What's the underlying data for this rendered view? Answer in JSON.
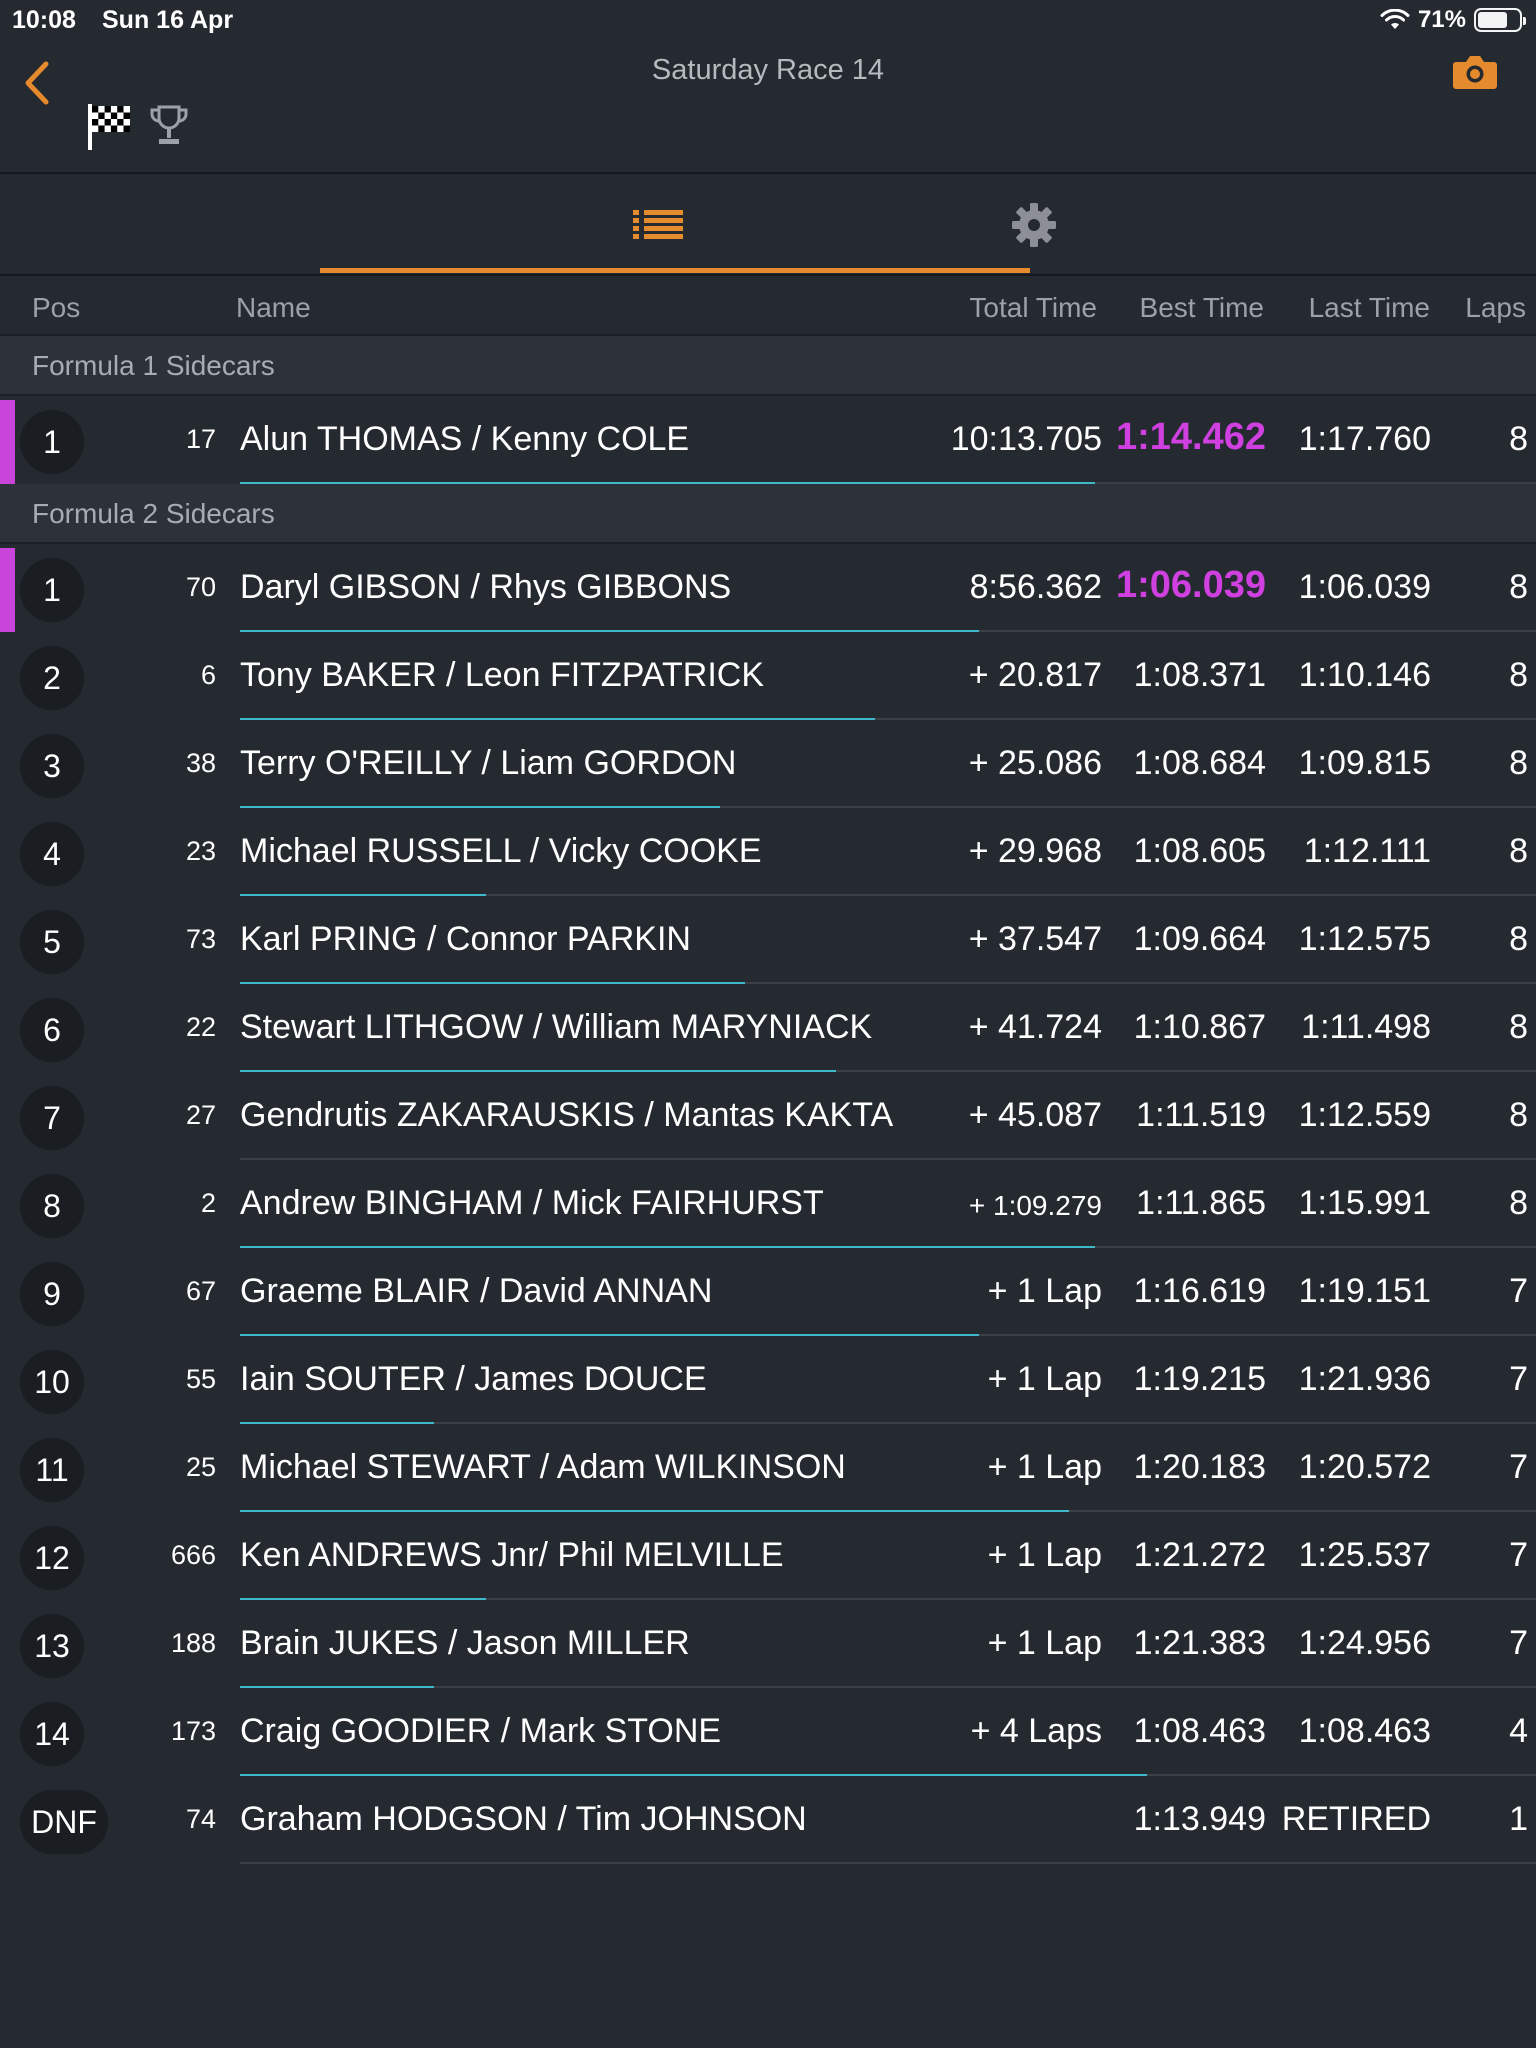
{
  "status_bar": {
    "time": "10:08",
    "date": "Sun 16 Apr",
    "battery": "71%"
  },
  "header": {
    "title": "Saturday Race 14"
  },
  "icons": {
    "back": "chevron-left-icon",
    "camera": "camera-icon",
    "flag": "checkered-flag-icon",
    "trophy": "trophy-icon",
    "list": "list-icon",
    "settings": "gear-icon"
  },
  "colors": {
    "accent": "#e68a2e",
    "fastest": "#d040e0",
    "progress": "#3fb9c8",
    "background": "#252a31"
  },
  "columns": {
    "pos": "Pos",
    "name": "Name",
    "total": "Total Time",
    "best": "Best Time",
    "last": "Last Time",
    "laps": "Laps"
  },
  "groups": [
    {
      "title": "Formula 1 Sidecars",
      "rows": [
        {
          "pos": "1",
          "num": "17",
          "name": "Alun THOMAS / Kenny COLE",
          "total": "10:13.705",
          "best": "1:14.462",
          "last": "1:17.760",
          "laps": "8",
          "leader": true,
          "fastest": true,
          "progress": 0.66
        }
      ]
    },
    {
      "title": "Formula 2 Sidecars",
      "rows": [
        {
          "pos": "1",
          "num": "70",
          "name": "Daryl GIBSON / Rhys GIBBONS",
          "total": "8:56.362",
          "best": "1:06.039",
          "last": "1:06.039",
          "laps": "8",
          "leader": true,
          "fastest": true,
          "progress": 0.57
        },
        {
          "pos": "2",
          "num": "6",
          "name": "Tony BAKER / Leon FITZPATRICK",
          "total": "+ 20.817",
          "best": "1:08.371",
          "last": "1:10.146",
          "laps": "8",
          "progress": 0.49
        },
        {
          "pos": "3",
          "num": "38",
          "name": "Terry O'REILLY /  Liam GORDON",
          "total": "+ 25.086",
          "best": "1:08.684",
          "last": "1:09.815",
          "laps": "8",
          "progress": 0.37
        },
        {
          "pos": "4",
          "num": "23",
          "name": "Michael RUSSELL /  Vicky COOKE",
          "total": "+ 29.968",
          "best": "1:08.605",
          "last": "1:12.111",
          "laps": "8",
          "progress": 0.19
        },
        {
          "pos": "5",
          "num": "73",
          "name": "Karl PRING / Connor PARKIN",
          "total": "+ 37.547",
          "best": "1:09.664",
          "last": "1:12.575",
          "laps": "8",
          "progress": 0.39
        },
        {
          "pos": "6",
          "num": "22",
          "name": "Stewart LITHGOW / William MARYNIACK",
          "total": "+ 41.724",
          "best": "1:10.867",
          "last": "1:11.498",
          "laps": "8",
          "progress": 0.46
        },
        {
          "pos": "7",
          "num": "27",
          "name": "Gendrutis ZAKARAUSKIS / Mantas KAKTA",
          "total": "+ 45.087",
          "best": "1:11.519",
          "last": "1:12.559",
          "laps": "8",
          "progress": 0.0
        },
        {
          "pos": "8",
          "num": "2",
          "name": "Andrew BINGHAM /  Mick FAIRHURST",
          "total": "+ 1:09.279",
          "best": "1:11.865",
          "last": "1:15.991",
          "laps": "8",
          "small_total": true,
          "progress": 0.66
        },
        {
          "pos": "9",
          "num": "67",
          "name": "Graeme BLAIR /  David ANNAN",
          "total": "+ 1 Lap",
          "best": "1:16.619",
          "last": "1:19.151",
          "laps": "7",
          "progress": 0.57
        },
        {
          "pos": "10",
          "num": "55",
          "name": "Iain SOUTER / James DOUCE",
          "total": "+ 1 Lap",
          "best": "1:19.215",
          "last": "1:21.936",
          "laps": "7",
          "progress": 0.15
        },
        {
          "pos": "11",
          "num": "25",
          "name": "Michael STEWART / Adam WILKINSON",
          "total": "+ 1 Lap",
          "best": "1:20.183",
          "last": "1:20.572",
          "laps": "7",
          "progress": 0.64
        },
        {
          "pos": "12",
          "num": "666",
          "name": "Ken ANDREWS Jnr/ Phil MELVILLE",
          "total": "+ 1 Lap",
          "best": "1:21.272",
          "last": "1:25.537",
          "laps": "7",
          "progress": 0.19
        },
        {
          "pos": "13",
          "num": "188",
          "name": "Brain JUKES / Jason MILLER",
          "total": "+ 1 Lap",
          "best": "1:21.383",
          "last": "1:24.956",
          "laps": "7",
          "progress": 0.15
        },
        {
          "pos": "14",
          "num": "173",
          "name": "Craig GOODIER / Mark STONE",
          "total": "+ 4 Laps",
          "best": "1:08.463",
          "last": "1:08.463",
          "laps": "4",
          "progress": 0.7
        },
        {
          "pos": "DNF",
          "num": "74",
          "name": "Graham HODGSON / Tim JOHNSON",
          "total": "",
          "best": "1:13.949",
          "last": "RETIRED",
          "laps": "1",
          "progress": 0.0
        }
      ]
    }
  ]
}
